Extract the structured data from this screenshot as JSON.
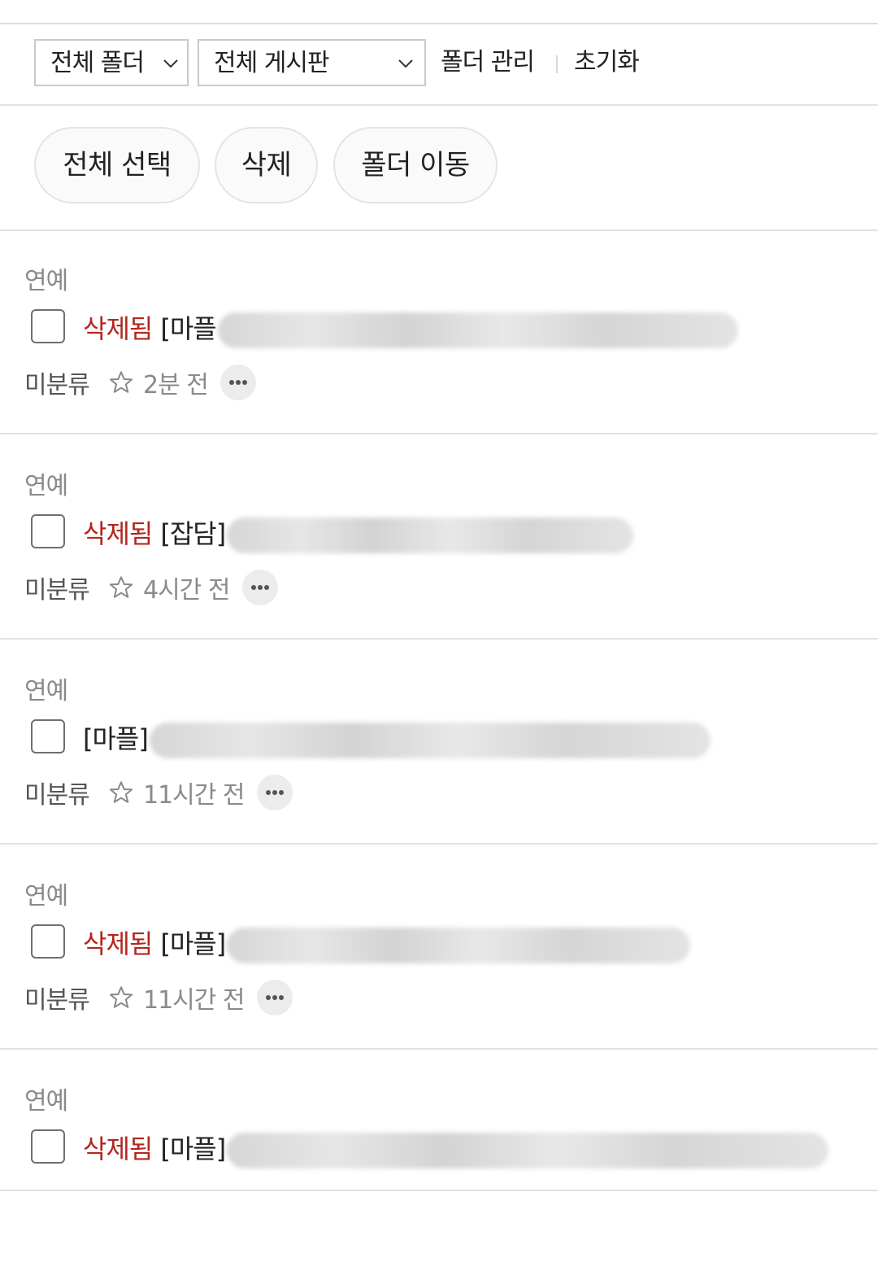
{
  "filters": {
    "folder_select": "전체 폴더",
    "board_select": "전체 게시판",
    "folder_manage": "폴더 관리",
    "reset": "초기화"
  },
  "actions": {
    "select_all": "전체 선택",
    "delete": "삭제",
    "move_folder": "폴더 이동"
  },
  "posts": [
    {
      "category": "연예",
      "deleted_label": "삭제됨",
      "tag": "[마플",
      "folder": "미분류",
      "time": "2분 전"
    },
    {
      "category": "연예",
      "deleted_label": "삭제됨",
      "tag": "[잡담]",
      "folder": "미분류",
      "time": "4시간 전"
    },
    {
      "category": "연예",
      "deleted_label": "",
      "tag": "[마플]",
      "folder": "미분류",
      "time": "11시간 전"
    },
    {
      "category": "연예",
      "deleted_label": "삭제됨",
      "tag": "[마플]",
      "folder": "미분류",
      "time": "11시간 전"
    },
    {
      "category": "연예",
      "deleted_label": "삭제됨",
      "tag": "[마플]"
    }
  ],
  "colors": {
    "deleted": "#b3261e",
    "divider": "#e2e2e2"
  },
  "icons": {
    "select_chevron": "chevron-down-icon",
    "favorite": "star-outline-icon",
    "more": "more-horizontal-icon"
  }
}
